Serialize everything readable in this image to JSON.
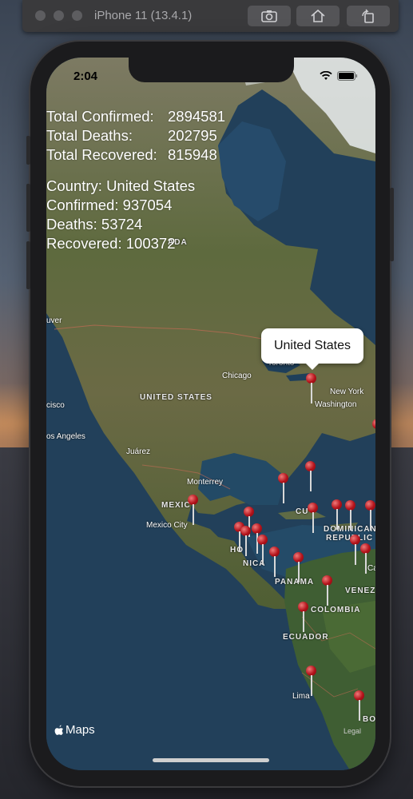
{
  "simulator": {
    "title": "iPhone 11 (13.4.1)"
  },
  "status_bar": {
    "time": "2:04"
  },
  "global_stats": {
    "confirmed_label": "Total Confirmed:",
    "confirmed_value": "2894581",
    "deaths_label": "Total Deaths:",
    "deaths_value": "202795",
    "recovered_label": "Total Recovered:",
    "recovered_value": "815948"
  },
  "country_stats": {
    "country_label": "Country:",
    "country_value": "United States",
    "confirmed_label": "Confirmed:",
    "confirmed_value": "937054",
    "deaths_label": "Deaths:",
    "deaths_value": "53724",
    "recovered_label": "Recovered:",
    "recovered_value": "100372"
  },
  "map": {
    "callout": "United States",
    "labels": {
      "canada": "ADA",
      "chicago": "Chicago",
      "toronto": "Toronto",
      "new_york": "New York",
      "washington": "Washington",
      "united_states": "UNITED STATES",
      "san_francisco": "cisco",
      "vancouver": "uver",
      "los_angeles": "os Angeles",
      "juarez": "Juárez",
      "monterrey": "Monterrey",
      "mexico": "MEXIC",
      "mexico_city": "Mexico City",
      "cuba": "CU",
      "dominican": "DOMINICAN",
      "republic": "REPUBLIC",
      "honduras": "HO",
      "nicaragua": "NICA",
      "panama": "PANAMA",
      "venezuela": "VENEZ",
      "colombia": "COLOMBIA",
      "ecuador": "ECUADOR",
      "lima": "Lima",
      "bolivia": "BOI",
      "caracas": "Ca"
    },
    "attribution": "Maps",
    "legal": "Legal"
  },
  "colors": {
    "pin": "#b3121a",
    "ocean": "#21415a",
    "land": "#5c6a3f"
  }
}
